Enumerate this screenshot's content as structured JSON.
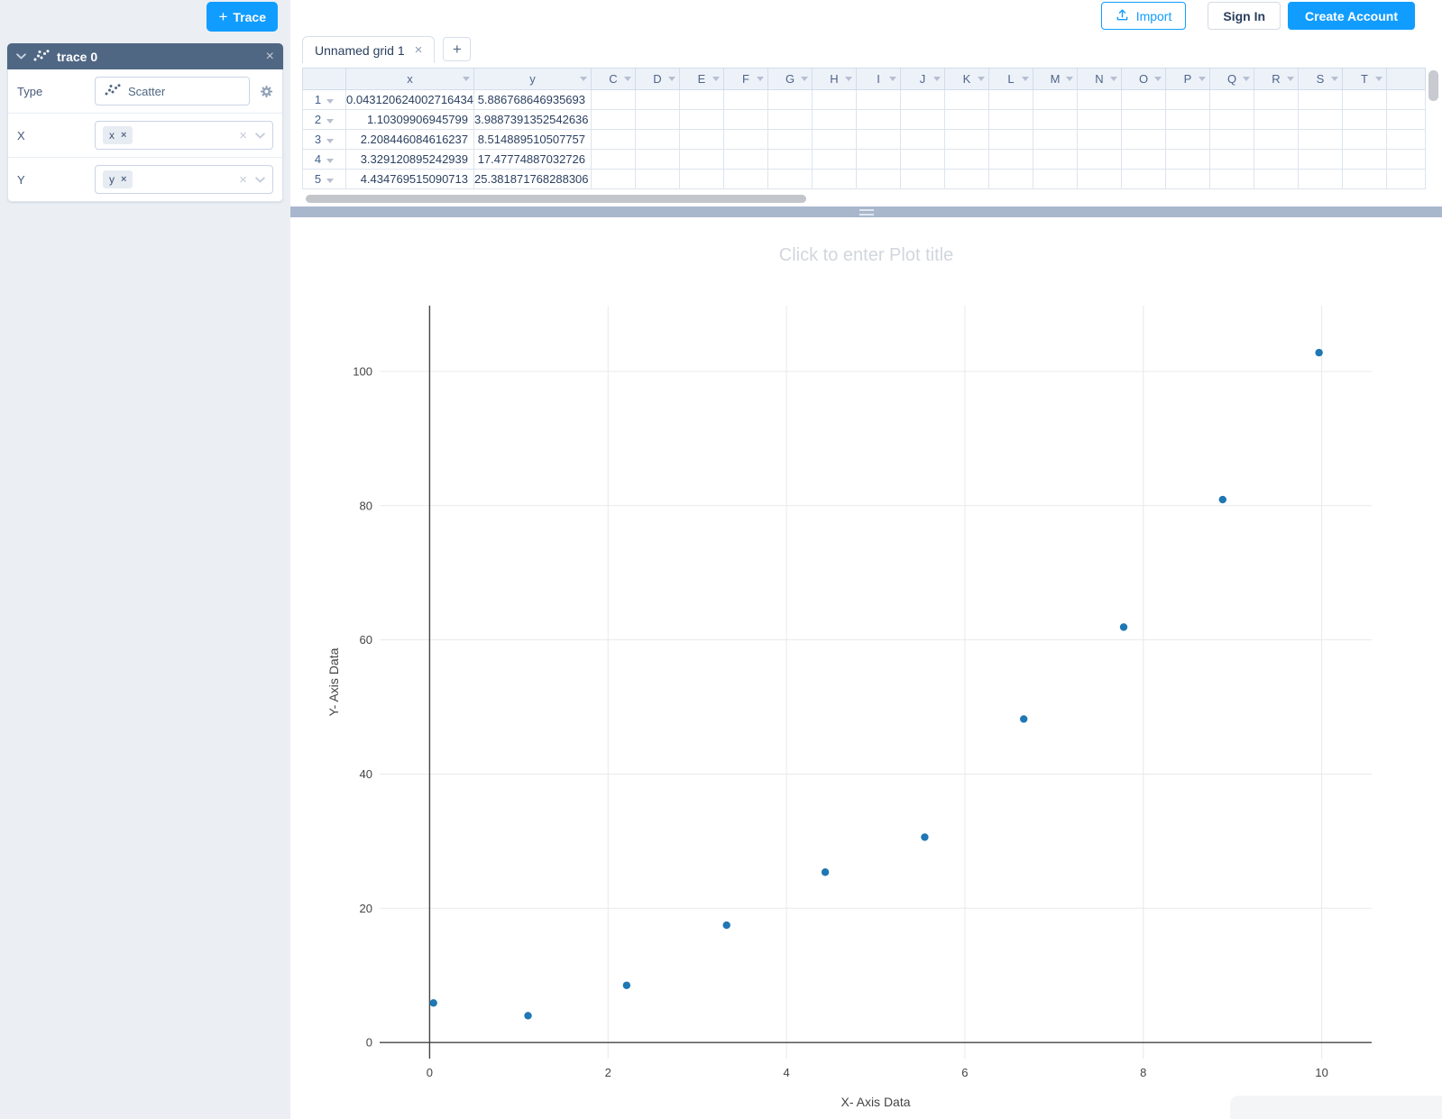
{
  "colors": {
    "accent_blue": "#119dff",
    "panel_header": "#506784",
    "divider": "#a9b7cd",
    "marker": "#1f77b4"
  },
  "topbar": {
    "import_label": "Import",
    "sign_in_label": "Sign In",
    "create_account_label": "Create Account"
  },
  "sidebar": {
    "add_trace_plus": "+",
    "add_trace_label": "Trace",
    "panel": {
      "title": "trace 0",
      "collapse_icon": "chevron-down",
      "close_icon": "×",
      "type_label": "Type",
      "type_value": "Scatter",
      "x_label": "X",
      "x_chip": "x",
      "y_label": "Y",
      "y_chip": "y",
      "chip_remove_icon": "×",
      "clear_icon": "×"
    }
  },
  "grid": {
    "tab_label": "Unnamed grid 1",
    "tab_close_icon": "×",
    "add_tab_label": "+",
    "data_columns": [
      "x",
      "y"
    ],
    "letter_columns": [
      "C",
      "D",
      "E",
      "F",
      "G",
      "H",
      "I",
      "J",
      "K",
      "L",
      "M",
      "N",
      "O",
      "P",
      "Q",
      "R",
      "S",
      "T"
    ],
    "rows": [
      {
        "num": "1",
        "x": "0.043120624002716434",
        "y": "5.886768646935693"
      },
      {
        "num": "2",
        "x": "1.10309906945799",
        "y": "3.9887391352542636"
      },
      {
        "num": "3",
        "x": "2.208446084616237",
        "y": "8.514889510507757"
      },
      {
        "num": "4",
        "x": "3.329120895242939",
        "y": "17.47774887032726"
      },
      {
        "num": "5",
        "x": "4.434769515090713",
        "y": "25.381871768288306"
      }
    ]
  },
  "chart_data": {
    "type": "scatter",
    "title_placeholder": "Click to enter Plot title",
    "xlabel": "X- Axis Data",
    "ylabel": "Y- Axis Data",
    "x": [
      0.043120624002716434,
      1.10309906945799,
      2.208446084616237,
      3.329120895242939,
      4.434769515090713,
      5.55,
      6.66,
      7.78,
      8.89,
      9.97
    ],
    "y": [
      5.886768646935693,
      3.9887391352542636,
      8.514889510507757,
      17.47774887032726,
      25.381871768288306,
      30.6,
      48.2,
      61.9,
      80.9,
      102.8
    ],
    "xticks": [
      0,
      2,
      4,
      6,
      8,
      10
    ],
    "yticks": [
      0,
      20,
      40,
      60,
      80,
      100
    ],
    "xlim": [
      -0.56,
      10.56
    ],
    "ylim": [
      -2.4,
      109.8
    ],
    "grid": true,
    "legend": false,
    "gridline_color": "#e9e9e9",
    "zeroline_color": "#444444",
    "tick_color": "#444444",
    "marker_color": "#1f77b4"
  }
}
